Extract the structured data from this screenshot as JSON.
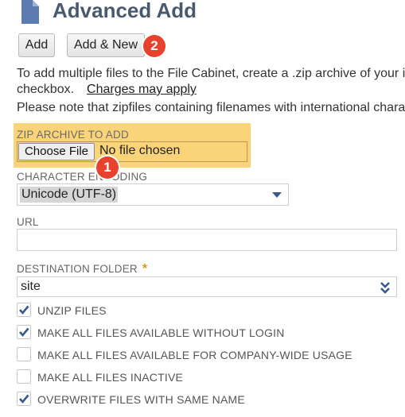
{
  "header": {
    "title": "Advanced Add",
    "icon": "document-icon"
  },
  "toolbar": {
    "add_label": "Add",
    "add_new_label": "Add & New",
    "badge_add_new": "2"
  },
  "description": {
    "line1": "To add multiple files to the File Cabinet, create a .zip archive of your ite",
    "line2": "checkbox.",
    "charges_link": "Charges may apply",
    "line3": "Please note that zipfiles containing filenames with international charac"
  },
  "zip_archive": {
    "label": "ZIP ARCHIVE TO ADD",
    "choose_file_label": "Choose File",
    "status": "No file chosen",
    "badge": "1",
    "highlight_color": "#fbd378"
  },
  "character_encoding": {
    "label": "CHARACTER ENCODING",
    "selected": "Unicode (UTF-8)"
  },
  "url": {
    "label": "URL",
    "value": ""
  },
  "destination_folder": {
    "label": "DESTINATION FOLDER",
    "required_marker": "*",
    "selected": "site"
  },
  "options": [
    {
      "label": "UNZIP FILES",
      "checked": true
    },
    {
      "label": "MAKE ALL FILES AVAILABLE WITHOUT LOGIN",
      "checked": true
    },
    {
      "label": "MAKE ALL FILES AVAILABLE FOR COMPANY-WIDE USAGE",
      "checked": false
    },
    {
      "label": "MAKE ALL FILES INACTIVE",
      "checked": false
    },
    {
      "label": "OVERWRITE FILES WITH SAME NAME",
      "checked": true
    }
  ],
  "colors": {
    "accent": "#3a5b8c",
    "badge": "#e8412e",
    "title": "#4a5a6e"
  }
}
